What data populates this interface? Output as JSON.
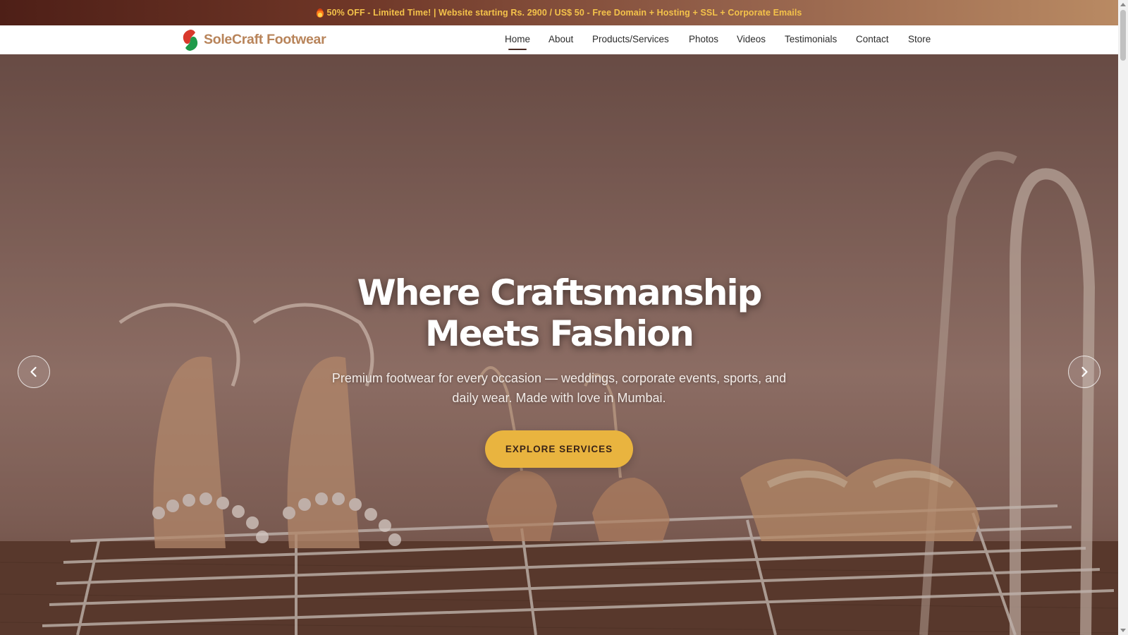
{
  "promo": {
    "icon": "fire-icon",
    "text": "50% OFF - Limited Time! | Website starting Rs. 2900 / US$ 50 - Free Domain + Hosting + SSL + Corporate Emails",
    "color": "#f4c24a"
  },
  "brand": {
    "name": "SoleCraft Footwear",
    "color": "#b8845a"
  },
  "nav": {
    "items": [
      {
        "label": "Home",
        "active": true
      },
      {
        "label": "About"
      },
      {
        "label": "Products/Services"
      },
      {
        "label": "Photos"
      },
      {
        "label": "Videos"
      },
      {
        "label": "Testimonials"
      },
      {
        "label": "Contact"
      },
      {
        "label": "Store"
      }
    ]
  },
  "hero": {
    "title_line1": "Where Craftsmanship",
    "title_line2": "Meets Fashion",
    "subtitle": "Premium footwear for every occasion — weddings, corporate events, sports, and daily wear. Made with love in Mumbai.",
    "cta": "EXPLORE SERVICES",
    "cta_color": "#e9b43f",
    "prev_icon": "chevron-left-icon",
    "next_icon": "chevron-right-icon"
  }
}
